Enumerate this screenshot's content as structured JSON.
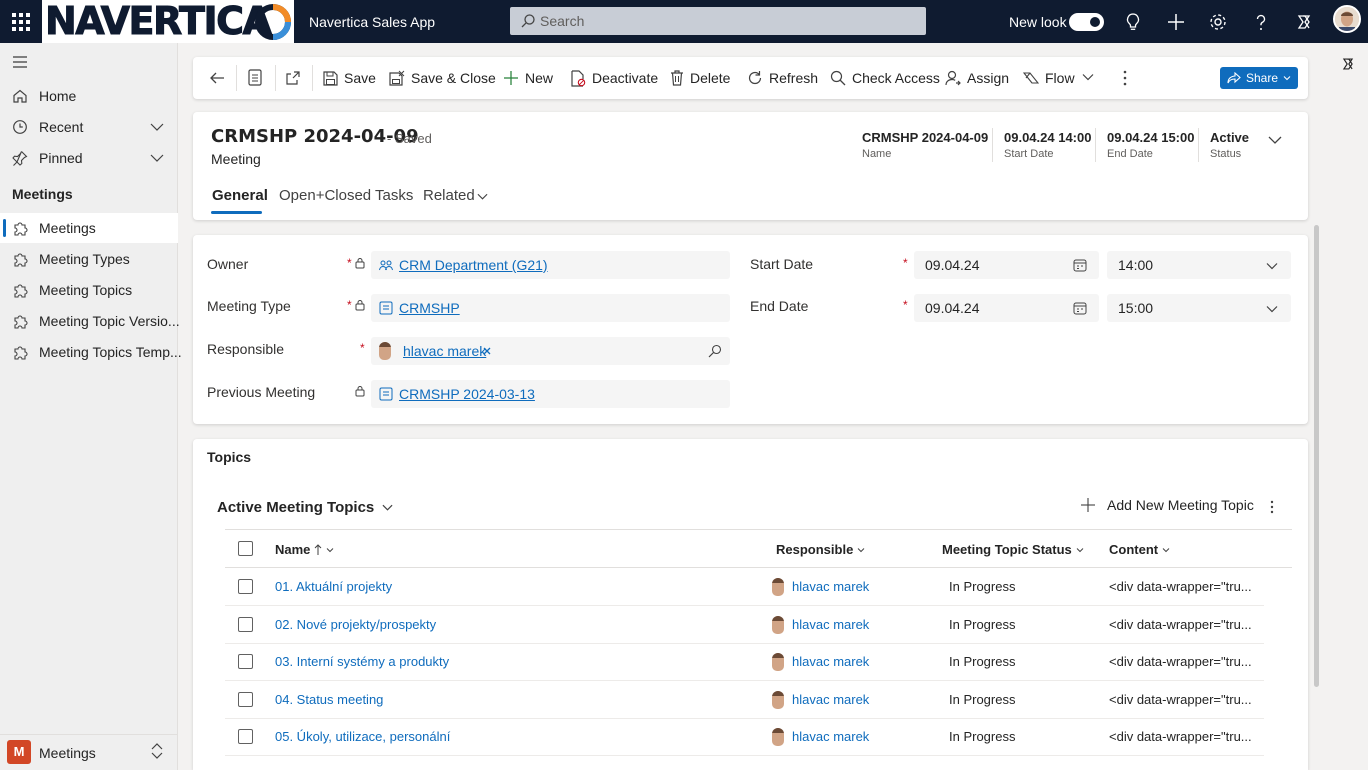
{
  "topbar": {
    "logo": "NAVERTICA",
    "app_title": "Navertica Sales App",
    "search_placeholder": "Search",
    "new_look_label": "New look",
    "new_look_on": true
  },
  "sidebar": {
    "items": [
      {
        "label": "Home",
        "icon": "home-icon"
      },
      {
        "label": "Recent",
        "icon": "clock-icon"
      },
      {
        "label": "Pinned",
        "icon": "pin-icon"
      }
    ],
    "group_title": "Meetings",
    "entities": [
      {
        "label": "Meetings",
        "active": true
      },
      {
        "label": "Meeting Types"
      },
      {
        "label": "Meeting Topics"
      },
      {
        "label": "Meeting Topic Versio..."
      },
      {
        "label": "Meeting Topics Temp..."
      }
    ],
    "area": {
      "badge": "M",
      "label": "Meetings"
    }
  },
  "commands": {
    "save": "Save",
    "save_close": "Save & Close",
    "new": "New",
    "deactivate": "Deactivate",
    "delete": "Delete",
    "refresh": "Refresh",
    "check_access": "Check Access",
    "assign": "Assign",
    "flow": "Flow",
    "share": "Share"
  },
  "header": {
    "title": "CRMSHP 2024-04-09",
    "saved": "- Saved",
    "entity": "Meeting",
    "fields": [
      {
        "value": "CRMSHP 2024-04-09",
        "label": "Name"
      },
      {
        "value": "09.04.24 14:00",
        "label": "Start Date"
      },
      {
        "value": "09.04.24 15:00",
        "label": "End Date"
      },
      {
        "value": "Active",
        "label": "Status"
      }
    ],
    "tabs": [
      "General",
      "Open+Closed Tasks",
      "Related"
    ]
  },
  "form": {
    "owner_label": "Owner",
    "owner_value": "CRM Department (G21)",
    "meeting_type_label": "Meeting Type",
    "meeting_type_value": "CRMSHP",
    "responsible_label": "Responsible",
    "responsible_value": "hlavac marek",
    "previous_label": "Previous Meeting",
    "previous_value": "CRMSHP 2024-03-13",
    "start_label": "Start Date",
    "start_date": "09.04.24",
    "start_time": "14:00",
    "end_label": "End Date",
    "end_date": "09.04.24",
    "end_time": "15:00",
    "required_mark": "*"
  },
  "topics": {
    "section_title": "Topics",
    "view_name": "Active Meeting Topics",
    "add_label": "Add New Meeting Topic",
    "columns": [
      "Name",
      "Responsible",
      "Meeting Topic Status",
      "Content"
    ],
    "rows": [
      {
        "name": "01. Aktuální projekty",
        "responsible": "hlavac marek",
        "status": "In Progress",
        "content": "<div data-wrapper=\"tru..."
      },
      {
        "name": "02. Nové projekty/prospekty",
        "responsible": "hlavac marek",
        "status": "In Progress",
        "content": "<div data-wrapper=\"tru..."
      },
      {
        "name": "03. Interní systémy a produkty",
        "responsible": "hlavac marek",
        "status": "In Progress",
        "content": "<div data-wrapper=\"tru..."
      },
      {
        "name": "04. Status meeting",
        "responsible": "hlavac marek",
        "status": "In Progress",
        "content": "<div data-wrapper=\"tru..."
      },
      {
        "name": "05. Úkoly, utilizace, personální",
        "responsible": "hlavac marek",
        "status": "In Progress",
        "content": "<div data-wrapper=\"tru..."
      }
    ]
  },
  "colors": {
    "topbar": "#0f1b30",
    "accent": "#0f6cbd",
    "required": "#c50f1f"
  }
}
